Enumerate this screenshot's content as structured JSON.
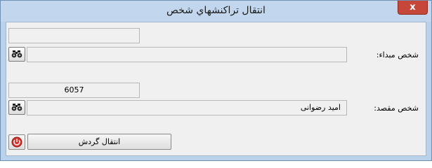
{
  "window": {
    "title": "انتقال تراكنشهاي شخص",
    "close_glyph": "x"
  },
  "source": {
    "code_value": "",
    "name_value": "",
    "label": "شخص مبداء:",
    "search_icon": "binoculars-icon"
  },
  "destination": {
    "code_value": "6057",
    "name_value": "امید رضوانی",
    "label": "شخص مقصد:",
    "search_icon": "binoculars-icon"
  },
  "actions": {
    "transfer_label": "انتقال گردش",
    "power_icon": "power-icon",
    "power_color": "#d9342b"
  }
}
